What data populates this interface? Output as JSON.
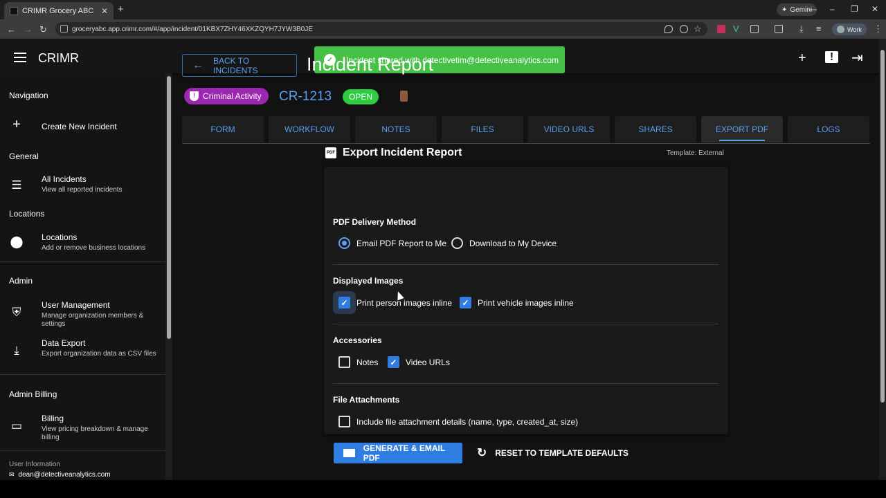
{
  "browser": {
    "tab_title": "CRIMR Grocery ABC",
    "url": "groceryabc.app.crimr.com/#/app/incident/01KBX7ZHY46XKZQYH7JYW3B0JE",
    "gemini_label": "Gemini",
    "profile_label": "Work"
  },
  "app": {
    "brand": "CRIMR",
    "toast": "Incident shared with detectivetim@detectiveanalytics.com"
  },
  "sidebar": {
    "navigation_header": "Navigation",
    "create_incident": "Create New Incident",
    "general_header": "General",
    "all_incidents": {
      "title": "All Incidents",
      "subtitle": "View all reported incidents"
    },
    "locations_header": "Locations",
    "locations": {
      "title": "Locations",
      "subtitle": "Add or remove business locations"
    },
    "admin_header": "Admin",
    "user_mgmt": {
      "title": "User Management",
      "subtitle": "Manage organization members & settings"
    },
    "data_export": {
      "title": "Data Export",
      "subtitle": "Export organization data as CSV files"
    },
    "billing_header": "Admin Billing",
    "billing": {
      "title": "Billing",
      "subtitle": "View pricing breakdown & manage billing"
    },
    "user_info_label": "User Information",
    "user_email": "dean@detectiveanalytics.com"
  },
  "incident": {
    "back_label": "BACK TO INCIDENTS",
    "title": "Incident Report",
    "category": "Criminal Activity",
    "number": "CR-1213",
    "status": "OPEN"
  },
  "tabs": [
    "FORM",
    "WORKFLOW",
    "NOTES",
    "FILES",
    "VIDEO URLS",
    "SHARES",
    "EXPORT PDF",
    "LOGS"
  ],
  "export": {
    "heading": "Export Incident Report",
    "template": "Template: External",
    "delivery_header": "PDF Delivery Method",
    "email_option": "Email PDF Report to Me",
    "download_option": "Download to My Device",
    "images_header": "Displayed Images",
    "person_images": "Print person images inline",
    "vehicle_images": "Print vehicle images inline",
    "accessories_header": "Accessories",
    "notes_option": "Notes",
    "video_option": "Video URLs",
    "attachments_header": "File Attachments",
    "attachment_option": "Include file attachment details (name, type, created_at, size)",
    "generate_label": "GENERATE & EMAIL PDF",
    "reset_label": "RESET TO TEMPLATE DEFAULTS"
  },
  "colors": {
    "accent": "#2f7de1",
    "toast": "#47c047",
    "chip": "#9c27b0",
    "open": "#2ecc40"
  }
}
